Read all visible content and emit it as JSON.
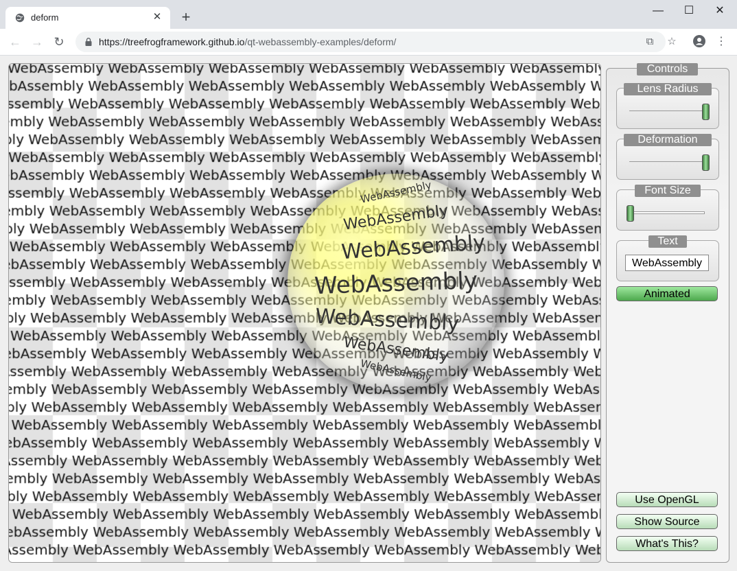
{
  "browser": {
    "tab_title": "deform",
    "tab_close": "✕",
    "new_tab": "+",
    "url_host": "https://treefrogframework.github.io",
    "url_path": "/qt-webassembly-examples/deform/",
    "window_controls": {
      "minimize": "—",
      "maximize": "☐",
      "close": "✕"
    }
  },
  "canvas": {
    "text": "WebAssembly"
  },
  "controls": {
    "title": "Controls",
    "lens_radius": {
      "label": "Lens Radius",
      "value": 1.0
    },
    "deformation": {
      "label": "Deformation",
      "value": 1.0
    },
    "font_size": {
      "label": "Font Size",
      "value": 0.0
    },
    "text_group": {
      "label": "Text",
      "value": "WebAssembly"
    },
    "animated_label": "Animated",
    "use_opengl_label": "Use OpenGL",
    "show_source_label": "Show Source",
    "whats_this_label": "What's This?"
  },
  "icons": {
    "favicon": "globe-icon",
    "lock": "lock-icon",
    "translate": "translate-icon",
    "star": "star-icon",
    "account": "account-icon",
    "menu": "kebab-menu-icon"
  }
}
